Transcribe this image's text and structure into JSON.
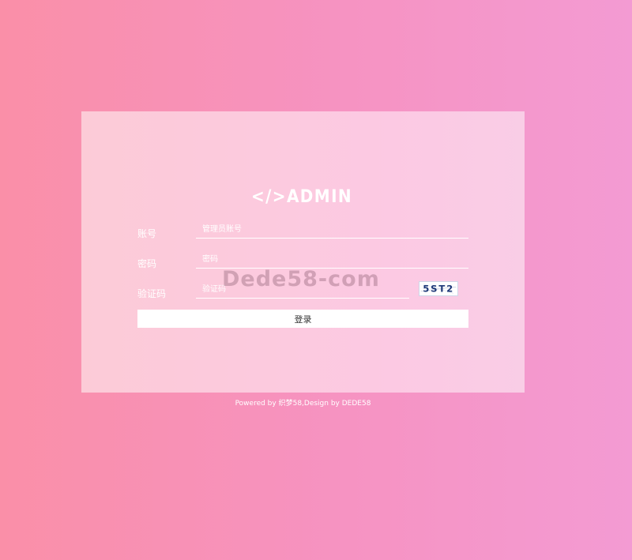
{
  "login": {
    "logo_text": "</>ADMIN",
    "account_label": "账号",
    "account_placeholder": "管理员账号",
    "password_label": "密码",
    "password_placeholder": "密码",
    "captcha_label": "验证码",
    "captcha_placeholder": "验证码",
    "captcha_text": "5ST2",
    "submit_label": "登录"
  },
  "watermark": "Dede58-com",
  "footer": "Powered by 织梦58,Design by DEDE58",
  "colors": {
    "background_left": "#fa8fa8",
    "background_right": "#f39bd3",
    "card_tint": "#fcc9e3",
    "field_line": "#ffffff"
  }
}
